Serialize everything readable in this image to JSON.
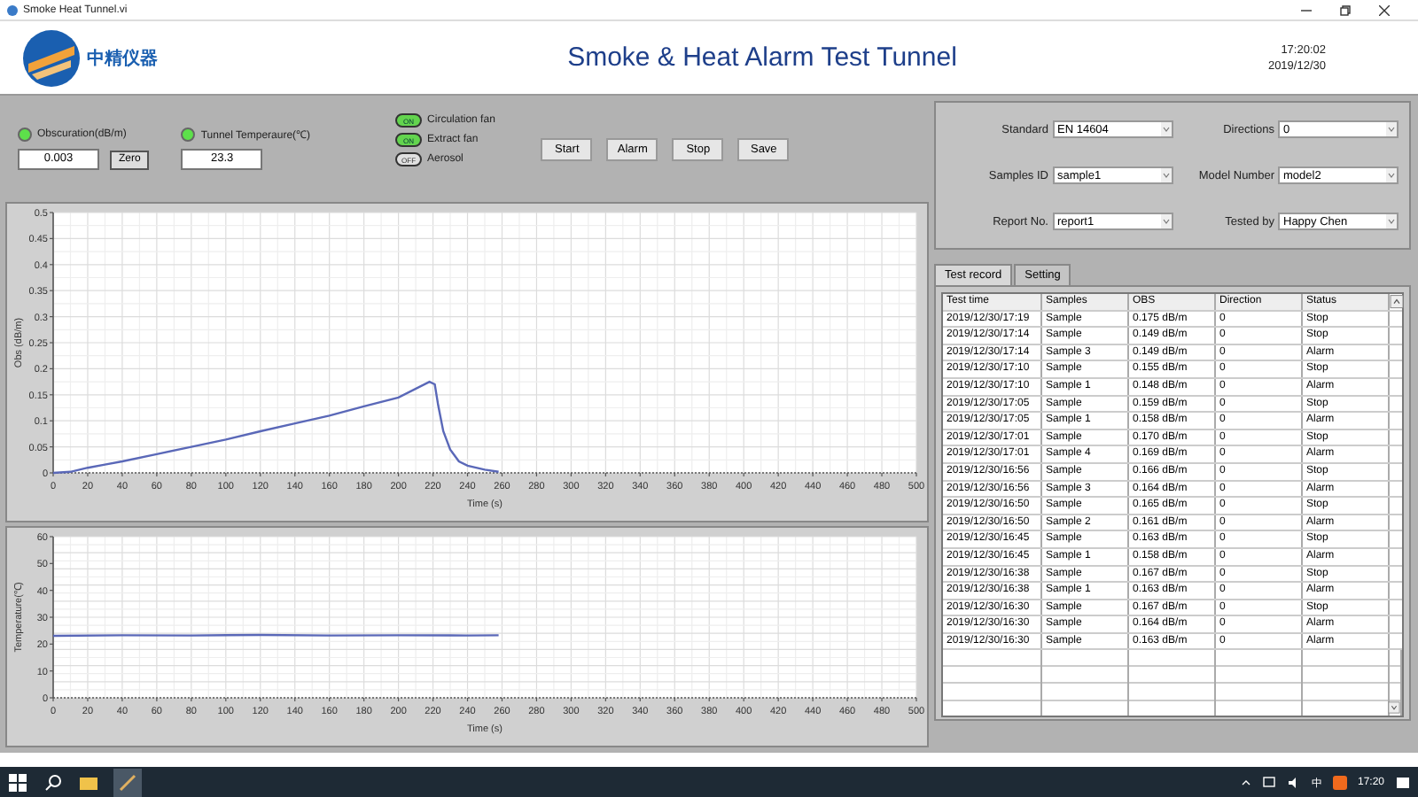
{
  "window": {
    "title": "Smoke Heat Tunnel.vi"
  },
  "header": {
    "logo_text": "中精仪器",
    "title": "Smoke & Heat Alarm Test Tunnel",
    "time": "17:20:02",
    "date": "2019/12/30"
  },
  "readouts": [
    {
      "label": "Obscuration(dB/m)",
      "on": true,
      "value": "0.003",
      "button": "Zero"
    },
    {
      "label": "Tunnel Temperaure(℃)",
      "on": true,
      "value": "23.3"
    }
  ],
  "switches": [
    {
      "label": "Circulation fan",
      "on": true,
      "switch_text": "ON"
    },
    {
      "label": "Extract fan",
      "on": true,
      "switch_text": "ON"
    },
    {
      "label": "Aerosol",
      "on": false,
      "switch_text": "OFF"
    }
  ],
  "buttons": [
    "Start",
    "Alarm",
    "Stop",
    "Save"
  ],
  "obs_chart": {
    "chart_data": {
      "type": "line",
      "grid": true,
      "xlabel": "Time (s)",
      "ylabel": "Obs (dB/m)",
      "xlim": [
        0,
        500
      ],
      "ylim": [
        0,
        0.5
      ],
      "xticks": [
        0,
        20,
        40,
        60,
        80,
        100,
        120,
        140,
        160,
        180,
        200,
        220,
        240,
        260,
        280,
        300,
        320,
        340,
        360,
        380,
        400,
        420,
        440,
        460,
        480,
        500
      ],
      "yticks": [
        0,
        0.05,
        0.1,
        0.15,
        0.2,
        0.25,
        0.3,
        0.35,
        0.4,
        0.45,
        0.5
      ],
      "x": [
        0,
        10,
        20,
        30,
        40,
        60,
        80,
        100,
        120,
        140,
        160,
        180,
        200,
        218,
        221,
        223,
        226,
        230,
        235,
        240,
        250,
        258
      ],
      "series": [
        {
          "color": "#5a68b8",
          "values": [
            0,
            0.002,
            0.01,
            0.016,
            0.022,
            0.036,
            0.05,
            0.064,
            0.08,
            0.095,
            0.11,
            0.128,
            0.145,
            0.175,
            0.17,
            0.13,
            0.08,
            0.045,
            0.022,
            0.014,
            0.006,
            0.002
          ]
        }
      ]
    }
  },
  "temp_chart": {
    "chart_data": {
      "type": "line",
      "grid": true,
      "xlabel": "Time (s)",
      "ylabel": "Temperature(℃)",
      "xlim": [
        0,
        500
      ],
      "ylim": [
        0,
        60
      ],
      "xticks": [
        0,
        20,
        40,
        60,
        80,
        100,
        120,
        140,
        160,
        180,
        200,
        220,
        240,
        260,
        280,
        300,
        320,
        340,
        360,
        380,
        400,
        420,
        440,
        460,
        480,
        500
      ],
      "yticks": [
        0,
        10,
        20,
        30,
        40,
        50,
        60
      ],
      "x": [
        0,
        40,
        80,
        120,
        160,
        200,
        240,
        258
      ],
      "series": [
        {
          "color": "#5a68b8",
          "values": [
            23.1,
            23.3,
            23.2,
            23.4,
            23.2,
            23.3,
            23.2,
            23.3
          ]
        }
      ]
    }
  },
  "parameters": [
    {
      "label": "Standard",
      "value": "EN 14604"
    },
    {
      "label": "Directions",
      "value": "0"
    },
    {
      "label": "Samples ID",
      "value": "sample1"
    },
    {
      "label": "Model Number",
      "value": "model2"
    },
    {
      "label": "Report No.",
      "value": "report1"
    },
    {
      "label": "Tested by",
      "value": "Happy Chen"
    }
  ],
  "tabs": [
    {
      "label": "Test record",
      "selected": true
    },
    {
      "label": "Setting",
      "selected": false
    }
  ],
  "table": {
    "columns": [
      "Test time",
      "Samples",
      "OBS",
      "Direction",
      "Status"
    ],
    "rows": [
      [
        "2019/12/30/17:19",
        "Sample",
        "0.175 dB/m",
        "0",
        "Stop"
      ],
      [
        "2019/12/30/17:14",
        "Sample",
        "0.149 dB/m",
        "0",
        "Stop"
      ],
      [
        "2019/12/30/17:14",
        "Sample 3",
        "0.149 dB/m",
        "0",
        "Alarm"
      ],
      [
        "2019/12/30/17:10",
        "Sample",
        "0.155 dB/m",
        "0",
        "Stop"
      ],
      [
        "2019/12/30/17:10",
        "Sample 1",
        "0.148 dB/m",
        "0",
        "Alarm"
      ],
      [
        "2019/12/30/17:05",
        "Sample",
        "0.159 dB/m",
        "0",
        "Stop"
      ],
      [
        "2019/12/30/17:05",
        "Sample 1",
        "0.158 dB/m",
        "0",
        "Alarm"
      ],
      [
        "2019/12/30/17:01",
        "Sample",
        "0.170 dB/m",
        "0",
        "Stop"
      ],
      [
        "2019/12/30/17:01",
        "Sample 4",
        "0.169 dB/m",
        "0",
        "Alarm"
      ],
      [
        "2019/12/30/16:56",
        "Sample",
        "0.166 dB/m",
        "0",
        "Stop"
      ],
      [
        "2019/12/30/16:56",
        "Sample 3",
        "0.164 dB/m",
        "0",
        "Alarm"
      ],
      [
        "2019/12/30/16:50",
        "Sample",
        "0.165 dB/m",
        "0",
        "Stop"
      ],
      [
        "2019/12/30/16:50",
        "Sample 2",
        "0.161 dB/m",
        "0",
        "Alarm"
      ],
      [
        "2019/12/30/16:45",
        "Sample",
        "0.163 dB/m",
        "0",
        "Stop"
      ],
      [
        "2019/12/30/16:45",
        "Sample 1",
        "0.158 dB/m",
        "0",
        "Alarm"
      ],
      [
        "2019/12/30/16:38",
        "Sample",
        "0.167 dB/m",
        "0",
        "Stop"
      ],
      [
        "2019/12/30/16:38",
        "Sample 1",
        "0.163 dB/m",
        "0",
        "Alarm"
      ],
      [
        "2019/12/30/16:30",
        "Sample",
        "0.167 dB/m",
        "0",
        "Stop"
      ],
      [
        "2019/12/30/16:30",
        "Sample",
        "0.164 dB/m",
        "0",
        "Alarm"
      ],
      [
        "2019/12/30/16:30",
        "Sample",
        "0.163 dB/m",
        "0",
        "Alarm"
      ]
    ]
  },
  "taskbar": {
    "ime": "中",
    "clock": "17:20"
  }
}
